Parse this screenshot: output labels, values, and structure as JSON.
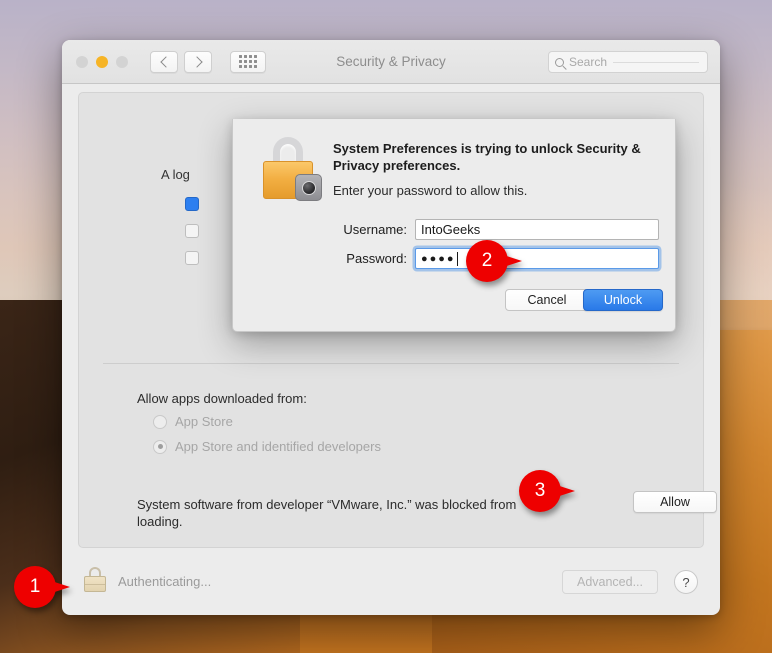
{
  "window": {
    "title": "Security & Privacy",
    "traffic_lights": [
      "close-button",
      "minimize-button",
      "zoom-button"
    ],
    "nav": {
      "back_icon": "chevron-left-icon",
      "forward_icon": "chevron-right-icon",
      "grid_icon": "show-all-grid-icon"
    },
    "search": {
      "placeholder": "Search",
      "icon": "search-icon",
      "value": ""
    }
  },
  "content": {
    "behind_text": "A log",
    "divider": true,
    "allow_apps_label": "Allow apps downloaded from:",
    "radios": [
      {
        "label": "App Store",
        "selected": false,
        "disabled": true
      },
      {
        "label": "App Store and identified developers",
        "selected": true,
        "disabled": true
      }
    ],
    "blocked_message": "System software from developer “VMware, Inc.” was blocked from loading.",
    "allow_button_label": "Allow"
  },
  "bottombar": {
    "lock_icon": "closed-padlock-icon",
    "status_text": "Authenticating...",
    "advanced_label": "Advanced...",
    "help_label": "?"
  },
  "sheet": {
    "lock_icon": "padlock-with-gear-icon",
    "title": "System Preferences is trying to unlock Security & Privacy preferences.",
    "subtitle": "Enter your password to allow this.",
    "username_label": "Username:",
    "username_value": "IntoGeeks",
    "password_label": "Password:",
    "password_value": "●●●●",
    "cancel_label": "Cancel",
    "unlock_label": "Unlock"
  },
  "callouts": [
    {
      "number": "1",
      "target": "bottom-lock"
    },
    {
      "number": "2",
      "target": "unlock-button"
    },
    {
      "number": "3",
      "target": "allow-button"
    }
  ],
  "colors": {
    "accent_blue": "#2979e8",
    "callout_red": "#ee0000",
    "minimize_yellow": "#f6b426",
    "lock_gold": "#f2ae42"
  }
}
